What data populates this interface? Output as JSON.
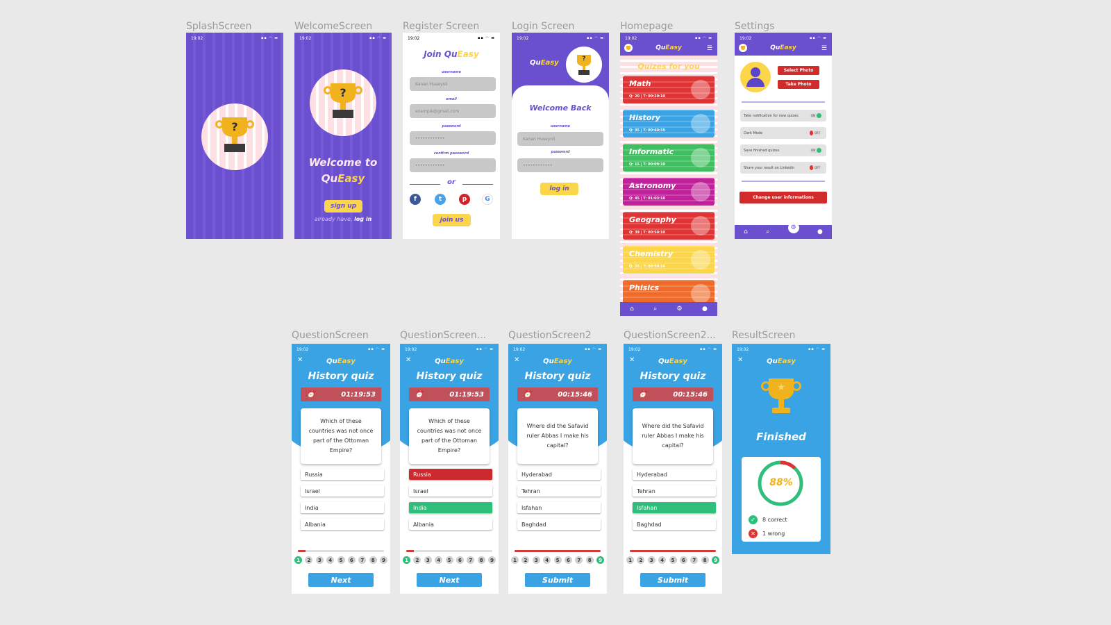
{
  "labels": {
    "splash": "SplashScreen",
    "welcome": "WelcomeScreen",
    "register": "Register Screen",
    "login": "Login Screen",
    "home": "Homepage",
    "settings": "Settings",
    "q1": "QuestionScreen",
    "q2": "QuestionScreen...",
    "q3": "QuestionScreen2",
    "q4": "QuestionScreen2...",
    "result": "ResultScreen"
  },
  "status_time": "19:02",
  "status_icons": "▪▪ ◠ ▬",
  "app": {
    "name_a": "Qu",
    "name_b": "Easy"
  },
  "welcome": {
    "line1": "Welcome to",
    "line2_a": "Qu",
    "line2_b": "Easy",
    "signup": "sign up",
    "already": "already have,",
    "login": "log in"
  },
  "register": {
    "title_a": "Join Qu",
    "title_b": "Easy",
    "username_label": "username",
    "username_value": "Kanan Huseynli",
    "email_label": "email",
    "email_placeholder": "example@gmail.com",
    "password_label": "password",
    "password_value": "••••••••••••",
    "confirm_label": "confirm password",
    "confirm_value": "••••••••••••",
    "or": "or",
    "join": "join us"
  },
  "login": {
    "title": "Welcome Back",
    "username_label": "username",
    "username_value": "Kanan Huseynli",
    "password_label": "password",
    "password_value": "••••••••••••",
    "login": "log in"
  },
  "home": {
    "heading": "Quizes for you",
    "cards": [
      {
        "title": "Math",
        "stats": "Q: 20 | T: 00:20:10",
        "color": "#e03333"
      },
      {
        "title": "History",
        "stats": "Q: 35 | T: 00:40:35",
        "color": "#3aa3e3"
      },
      {
        "title": "Informatic",
        "stats": "Q: 15 | T: 00:09:10",
        "color": "#3fbf5f"
      },
      {
        "title": "Astronomy",
        "stats": "Q: 45 | T: 01:03:10",
        "color": "#c0209a"
      },
      {
        "title": "Geography",
        "stats": "Q: 39 | T: 00:50:10",
        "color": "#e03333"
      },
      {
        "title": "Chemistry",
        "stats": "Q: 35 | T: 00:50:10",
        "color": "#fbd54a"
      },
      {
        "title": "Phisics",
        "stats": "",
        "color": "#f06a2a"
      }
    ]
  },
  "settings": {
    "select_photo": "Select Photo",
    "take_photo": "Take Photo",
    "rows": [
      {
        "label": "Take notification for new quizes",
        "state": "ON",
        "on": true
      },
      {
        "label": "Dark Mode",
        "state": "OFF",
        "on": false
      },
      {
        "label": "Save finished quizes",
        "state": "ON",
        "on": true
      },
      {
        "label": "Share your result on Linkedin",
        "state": "OFF",
        "on": false
      }
    ],
    "change": "Change user informations"
  },
  "quiz": {
    "title": "History quiz",
    "screens": [
      {
        "timer": "01:19:53",
        "question": "Which of these countries was not once part of the Ottoman Empire?",
        "answers": [
          "Russia",
          "Israel",
          "India",
          "Albania"
        ],
        "states": [
          "",
          "",
          "",
          ""
        ],
        "progress": 0.09,
        "current": 1,
        "button": "Next"
      },
      {
        "timer": "01:19:53",
        "question": "Which of these countries was not once part of the Ottoman Empire?",
        "answers": [
          "Russia",
          "Israel",
          "India",
          "Albania"
        ],
        "states": [
          "red",
          "",
          "green",
          ""
        ],
        "progress": 0.09,
        "current": 1,
        "button": "Next"
      },
      {
        "timer": "00:15:46",
        "question": "Where did the Safavid ruler Abbas I make his capital?",
        "answers": [
          "Hyderabad",
          "Tehran",
          "Isfahan",
          "Baghdad"
        ],
        "states": [
          "",
          "",
          "",
          ""
        ],
        "progress": 1.0,
        "current": 9,
        "button": "Submit"
      },
      {
        "timer": "00:15:46",
        "question": "Where did the Safavid ruler Abbas I make his capital?",
        "answers": [
          "Hyderabad",
          "Tehran",
          "Isfahan",
          "Baghdad"
        ],
        "states": [
          "",
          "",
          "green",
          ""
        ],
        "progress": 1.0,
        "current": 9,
        "button": "Submit"
      }
    ],
    "numbers": [
      "1",
      "2",
      "3",
      "4",
      "5",
      "6",
      "7",
      "8",
      "9"
    ]
  },
  "result": {
    "finished": "Finished",
    "percent": "88%",
    "percent_value": 88,
    "correct": "8 correct",
    "wrong": "1 wrong"
  }
}
